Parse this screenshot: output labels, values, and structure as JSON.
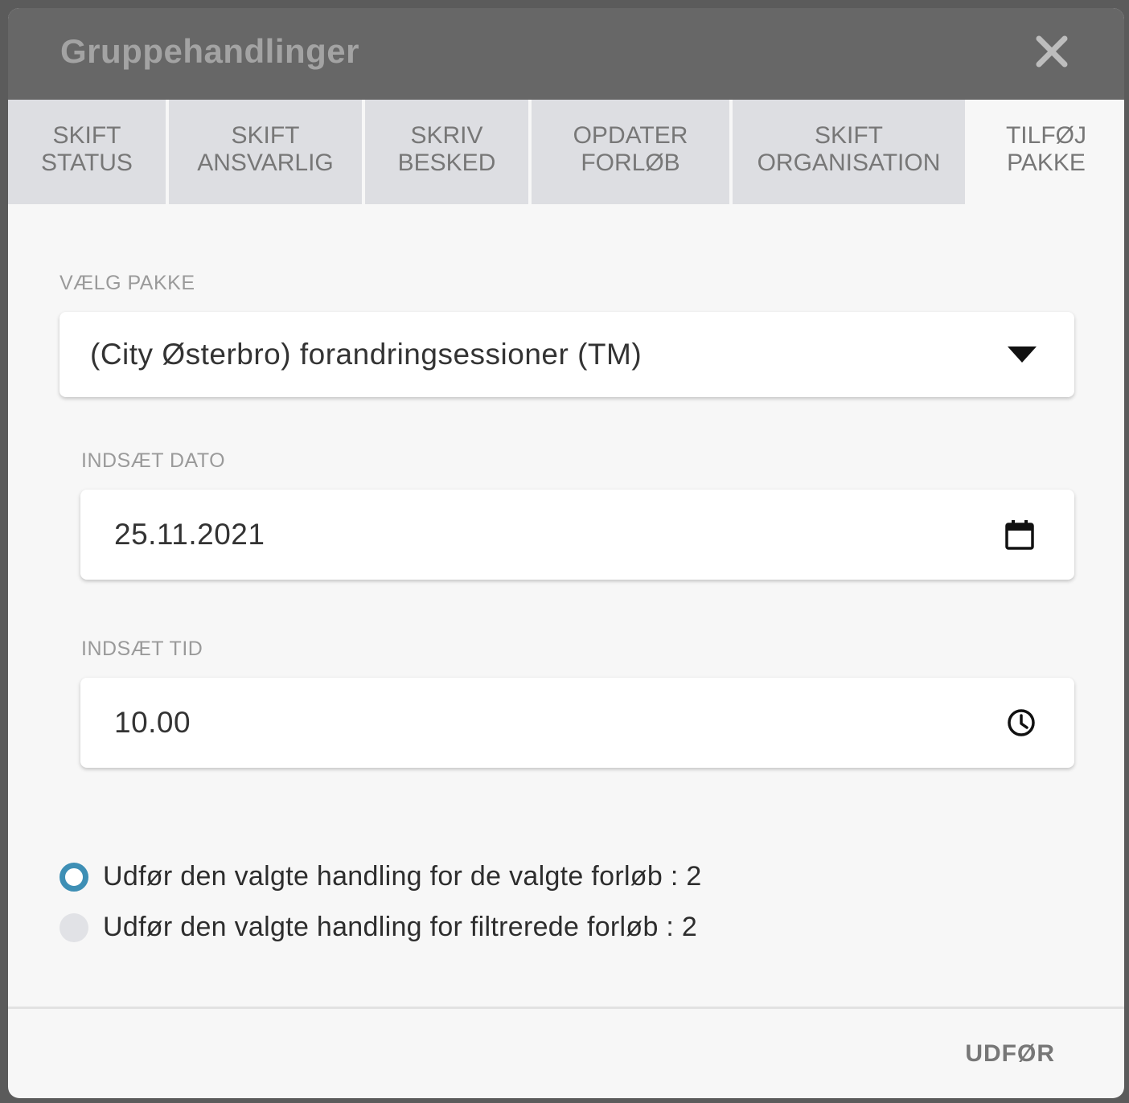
{
  "dialog": {
    "title": "Gruppehandlinger",
    "close_icon": "close-icon"
  },
  "tabs": [
    {
      "line1": "SKIFT",
      "line2": "STATUS",
      "active": false
    },
    {
      "line1": "SKIFT",
      "line2": "ANSVARLIG",
      "active": false
    },
    {
      "line1": "SKRIV",
      "line2": "BESKED",
      "active": false
    },
    {
      "line1": "OPDATER",
      "line2": "FORLØB",
      "active": false
    },
    {
      "line1": "SKIFT",
      "line2": "ORGANISATION",
      "active": false
    },
    {
      "line1": "TILFØJ",
      "line2": "PAKKE",
      "active": true
    }
  ],
  "package": {
    "label": "VÆLG PAKKE",
    "selected": "(City Østerbro) forandringsessioner (TM)",
    "icon": "dropdown-arrow-icon"
  },
  "date": {
    "label": "INDSÆT DATO",
    "value": "25.11.2021",
    "icon": "calendar-icon"
  },
  "time": {
    "label": "INDSÆT TID",
    "value": "10.00",
    "icon": "clock-icon"
  },
  "scope": {
    "options": [
      {
        "label": "Udfør den valgte handling for de valgte forløb : 2",
        "checked": true
      },
      {
        "label": "Udfør den valgte handling for filtrerede forløb : 2",
        "checked": false
      }
    ]
  },
  "footer": {
    "submit_label": "UDFØR"
  },
  "colors": {
    "header_bg": "#676767",
    "accent": "#3e8fb5",
    "tab_inactive_bg": "#dddee2"
  }
}
